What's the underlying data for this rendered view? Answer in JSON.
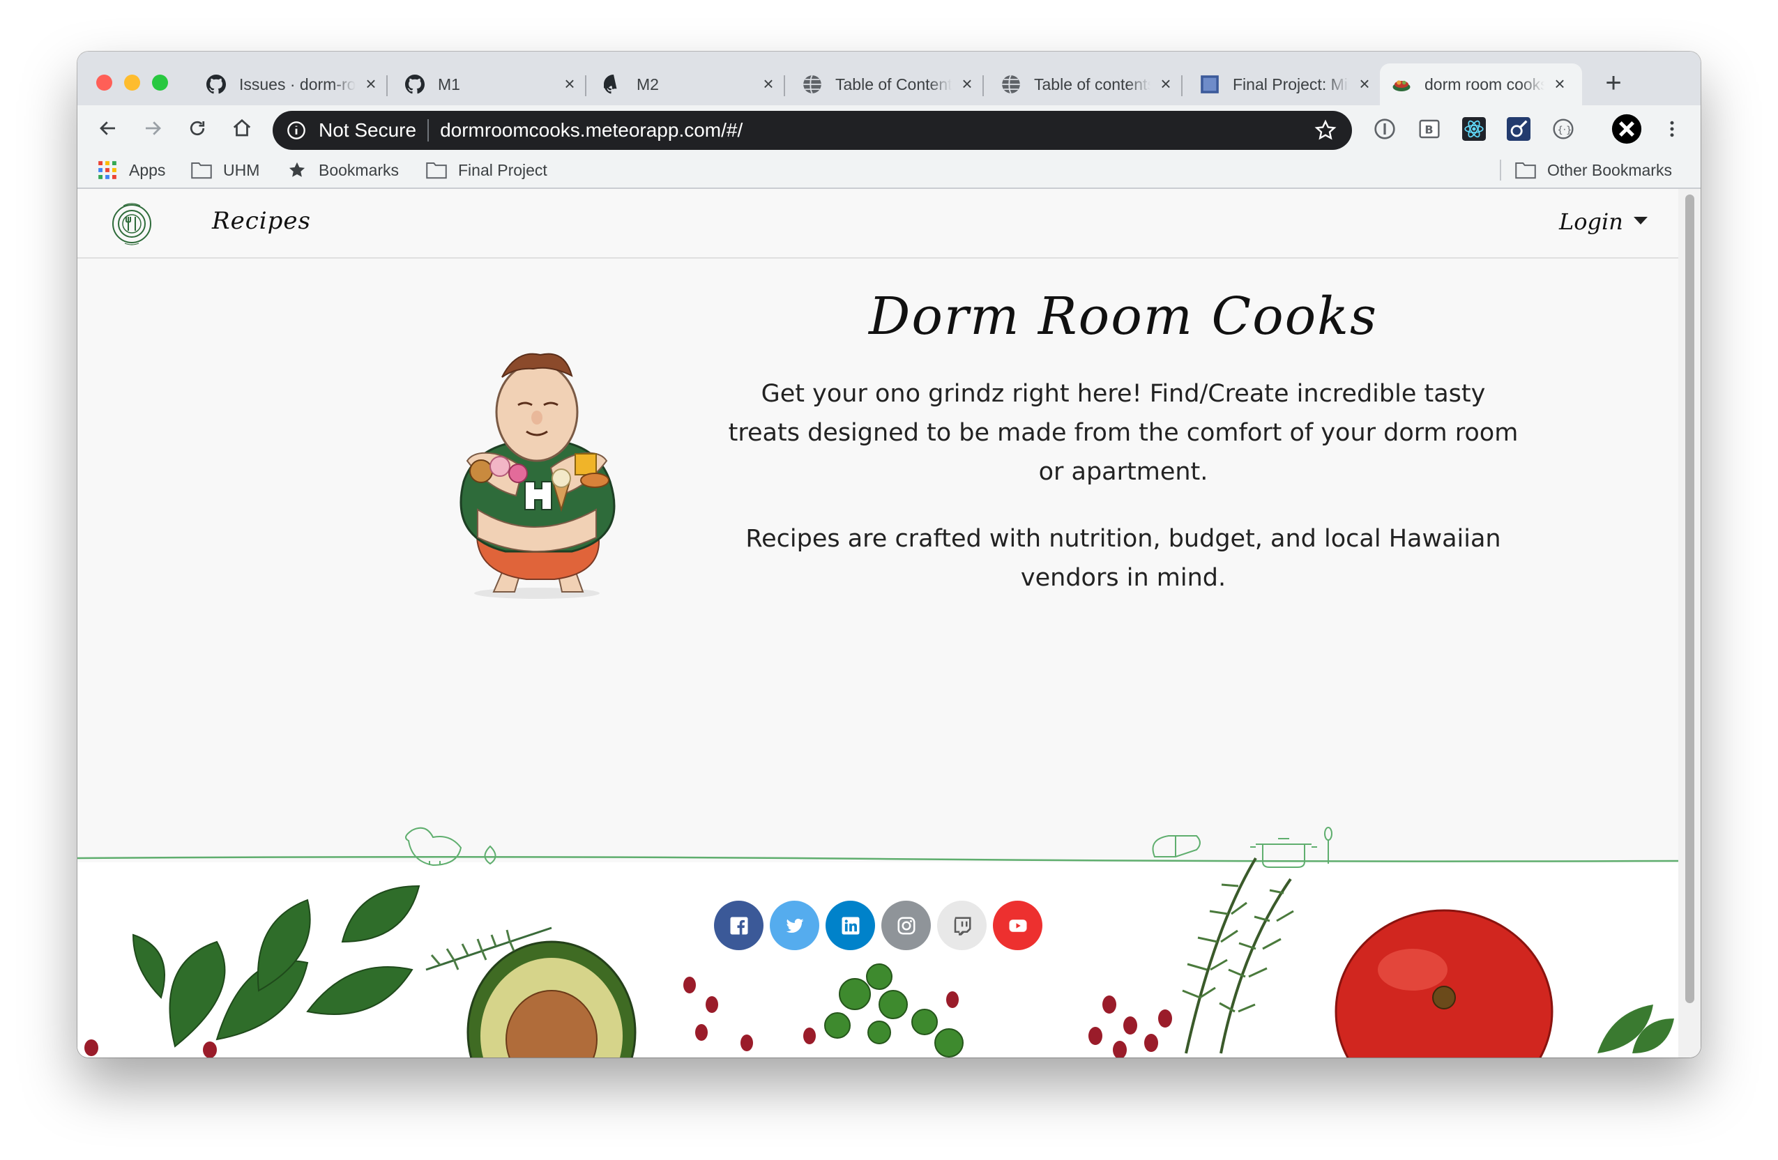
{
  "browser": {
    "tabs": [
      {
        "title": "Issues · dorm-room-cooks",
        "favicon": "github-icon"
      },
      {
        "title": "M1",
        "favicon": "github-icon"
      },
      {
        "title": "M2",
        "favicon": "github-icon"
      },
      {
        "title": "Table of Contents",
        "favicon": "globe-icon"
      },
      {
        "title": "Table of contents",
        "favicon": "globe-icon"
      },
      {
        "title": "Final Project: Milestone",
        "favicon": "square-icon"
      },
      {
        "title": "dorm room cooks",
        "favicon": "food-icon",
        "active": true
      }
    ],
    "security_label": "Not Secure",
    "url": "dormroomcooks.meteorapp.com/#/",
    "bookmarks": {
      "apps": "Apps",
      "uhm": "UHM",
      "bookmarks": "Bookmarks",
      "final_project": "Final Project",
      "other": "Other Bookmarks"
    }
  },
  "site": {
    "nav": {
      "recipes": "Recipes",
      "login": "Login"
    },
    "hero": {
      "title": "Dorm Room Cooks",
      "paragraph1": "Get your ono grindz right here! Find/Create incredible tasty treats designed to be made from the comfort of your dorm room or apartment.",
      "paragraph2": "Recipes are crafted with nutrition, budget, and local Hawaiian vendors in mind."
    },
    "socials": [
      {
        "name": "facebook",
        "color": "#3b5998"
      },
      {
        "name": "twitter",
        "color": "#55acee"
      },
      {
        "name": "linkedin",
        "color": "#0082ca"
      },
      {
        "name": "instagram",
        "color": "#8f9499"
      },
      {
        "name": "twitch",
        "color": "#e8e8e8"
      },
      {
        "name": "youtube",
        "color": "#ed302f"
      }
    ]
  }
}
